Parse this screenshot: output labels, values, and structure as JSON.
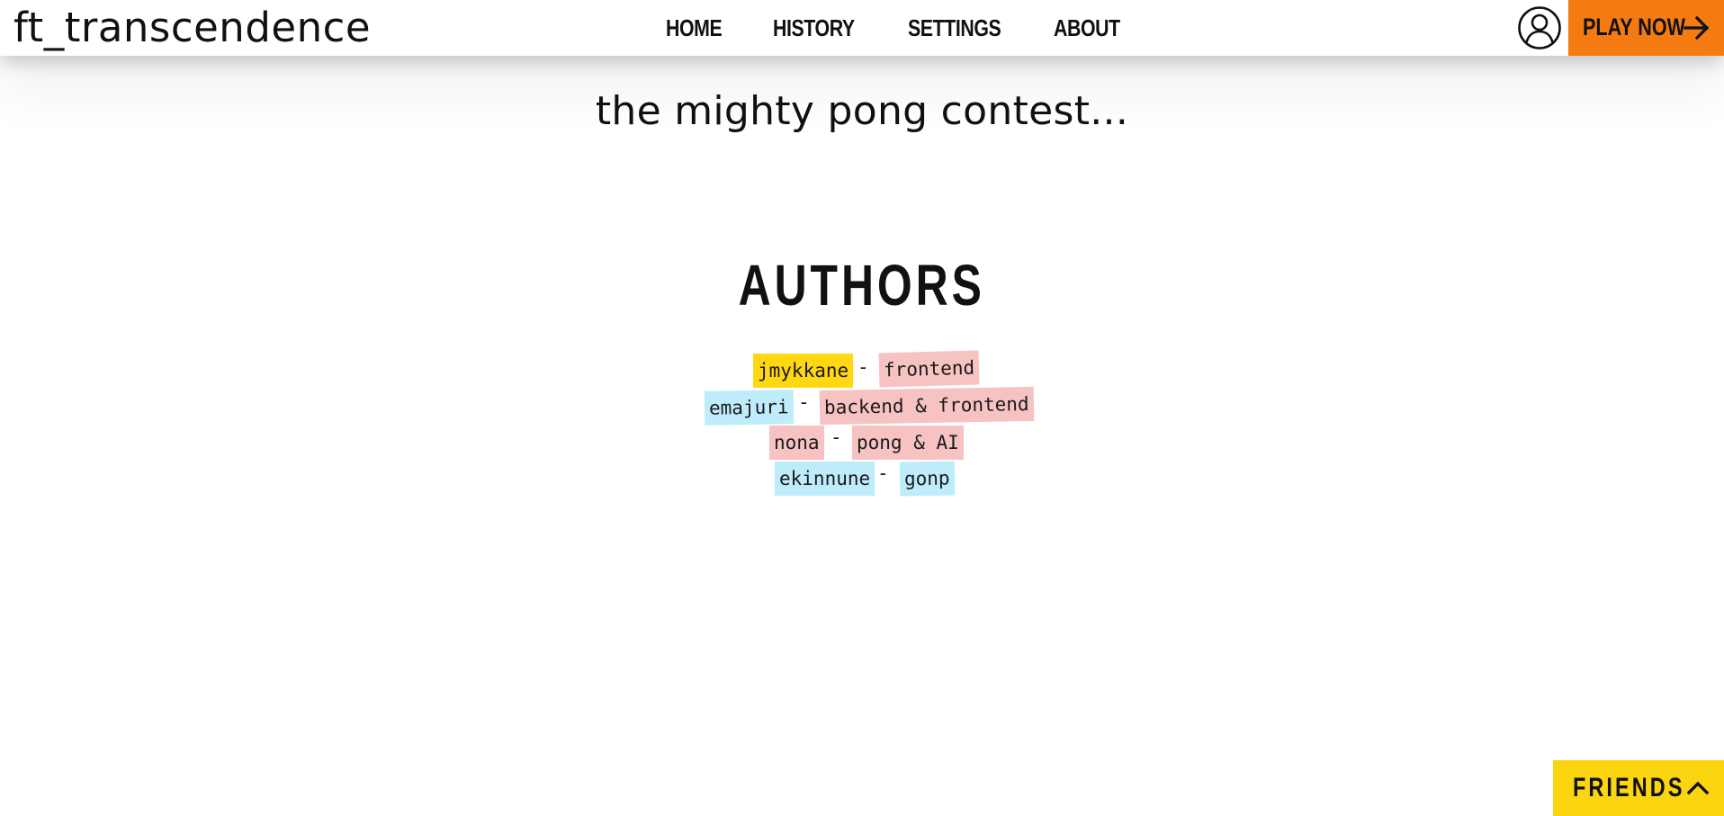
{
  "navbar": {
    "brand": "ft_transcendence",
    "links": [
      "HOME",
      "HISTORY",
      "SETTINGS",
      "ABOUT"
    ],
    "profile_icon": "user-circle-icon",
    "play_label": "PLAY NOW",
    "play_icon": "arrow-right-icon"
  },
  "main": {
    "tagline": "the mighty pong contest...",
    "authors_title": "AUTHORS",
    "authors": [
      {
        "name": "jmykkane",
        "role": "frontend",
        "name_color": "#ffd713",
        "role_color": "#f6c2c2"
      },
      {
        "name": "emajuri",
        "role": "backend & frontend",
        "name_color": "#bfecfb",
        "role_color": "#f6c2c2"
      },
      {
        "name": "nona",
        "role": "pong & AI",
        "name_color": "#f6c2c2",
        "role_color": "#f6c2c2"
      },
      {
        "name": "ekinnune",
        "role": "gonp",
        "name_color": "#bfecfb",
        "role_color": "#bfecfb"
      }
    ],
    "separator": "-"
  },
  "friends": {
    "label": "FRIENDS",
    "icon": "chevron-up-icon"
  },
  "colors": {
    "accent_orange": "#f47b12",
    "accent_yellow": "#fcd511"
  }
}
